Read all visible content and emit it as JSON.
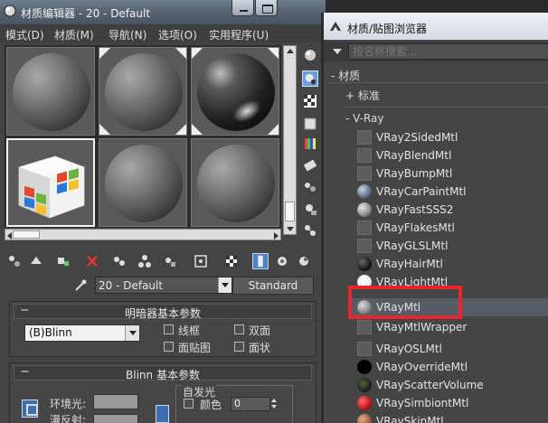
{
  "editor": {
    "title": "材质编辑器 - 20 - Default",
    "menu": [
      "模式(D)",
      "材质(M)",
      "导航(N)",
      "选项(O)",
      "实用程序(U)"
    ],
    "material_name": "20 - Default",
    "material_type": "Standard",
    "shader_rollout": {
      "title": "明暗器基本参数",
      "shader": "(B)Blinn",
      "options": [
        "线框",
        "双面",
        "面贴图",
        "面状"
      ]
    },
    "blinn_rollout": {
      "title": "Blinn 基本参数",
      "ambient_label": "环境光:",
      "diffuse_label": "漫反射:",
      "self_illum_label": "自发光",
      "color_label": "颜色",
      "self_illum_value": "0"
    },
    "colors": {
      "titlebar": "#55626f",
      "active_tool": "#4d84c4",
      "panel_bg": "#464646"
    }
  },
  "browser": {
    "title": "材质/贴图浏览器",
    "search_placeholder": "按名称搜索...",
    "group_materials": "- 材质",
    "group_standard": "+ 标准",
    "group_vray": "- V-Ray",
    "items": [
      "VRay2SidedMtl",
      "VRayBlendMtl",
      "VRayBumpMtl",
      "VRayCarPaintMtl",
      "VRayFastSSS2",
      "VRayFlakesMtl",
      "VRayGLSLMtl",
      "VRayHairMtl",
      "VRayLightMtl",
      "VRayMtl",
      "VRayMtlWrapper",
      "VRayOSLMtl",
      "VRayOverrideMtl",
      "VRayScatterVolume",
      "VRaySimbiontMtl",
      "VRaySkinMtl"
    ],
    "selected_item": "VRayMtl",
    "highlight_color": "#e8262b"
  }
}
